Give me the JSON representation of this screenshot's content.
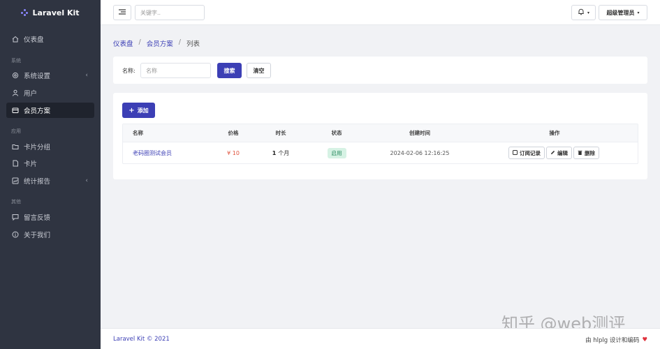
{
  "brand": {
    "name": "Laravel Kit"
  },
  "sidebar": {
    "items": [
      {
        "label": "仪表盘",
        "icon": "home-icon"
      },
      {
        "section": "系统"
      },
      {
        "label": "系统设置",
        "icon": "gear-icon",
        "has_children": true
      },
      {
        "label": "用户",
        "icon": "user-icon"
      },
      {
        "label": "会员方案",
        "icon": "card-icon",
        "active": true
      },
      {
        "section": "应用"
      },
      {
        "label": "卡片分组",
        "icon": "folder-icon"
      },
      {
        "label": "卡片",
        "icon": "file-icon"
      },
      {
        "label": "统计报告",
        "icon": "chart-icon",
        "has_children": true
      },
      {
        "section": "其他"
      },
      {
        "label": "留言反馈",
        "icon": "message-icon"
      },
      {
        "label": "关于我们",
        "icon": "info-icon"
      }
    ],
    "labels": {
      "dashboard": "仪表盘",
      "section_system": "系统",
      "settings": "系统设置",
      "users": "用户",
      "plans": "会员方案",
      "section_app": "应用",
      "card_groups": "卡片分组",
      "cards": "卡片",
      "reports": "统计报告",
      "section_other": "其他",
      "feedback": "留言反馈",
      "about": "关于我们"
    }
  },
  "topbar": {
    "search_placeholder": "关键字..",
    "user_label": "超级管理员"
  },
  "breadcrumb": {
    "home": "仪表盘",
    "parent": "会员方案",
    "current": "列表",
    "separator": "/"
  },
  "filter": {
    "name_label": "名称:",
    "name_placeholder": "名称",
    "search_button": "搜索",
    "clear_button": "清空"
  },
  "list": {
    "add_button": "添加",
    "columns": {
      "name": "名称",
      "price": "价格",
      "duration": "时长",
      "status": "状态",
      "created": "创建时间",
      "actions": "操作"
    },
    "rows": [
      {
        "name": "老码圈测试会员",
        "price": "¥ 10",
        "duration_num": "1",
        "duration_unit": "个月",
        "status": "启用",
        "created": "2024-02-06 12:16:25",
        "actions": {
          "orders": "订阅记录",
          "edit": "编辑",
          "delete": "删除"
        }
      }
    ]
  },
  "footer": {
    "left": "Laravel Kit © 2021",
    "right": "由 hlplg 设计和编码"
  },
  "watermark": "知乎 @web测评",
  "colors": {
    "accent": "#3c3fb5",
    "sidebar": "#2f3441",
    "price": "#e0533d",
    "status_bg": "#d6f2e4",
    "heart": "#e0323d"
  }
}
